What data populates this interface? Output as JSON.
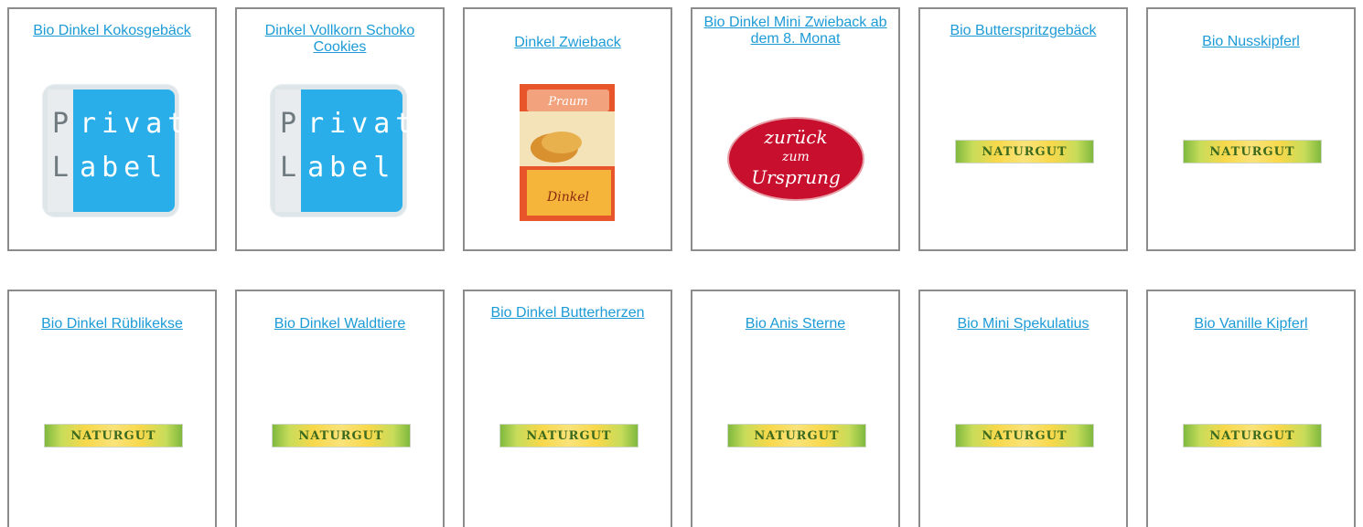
{
  "products": [
    {
      "title": "Bio Dinkel Kokosgebäck ",
      "logo": "private-label"
    },
    {
      "title": "Dinkel Vollkorn Schoko Cookies",
      "logo": "private-label"
    },
    {
      "title": "Dinkel Zwieback",
      "logo": "product-box"
    },
    {
      "title": "Bio Dinkel Mini Zwieback ab dem 8. Monat",
      "logo": "zurueck-zum-ursprung"
    },
    {
      "title": "Bio Butterspritzgebäck",
      "logo": "naturgut"
    },
    {
      "title": "Bio Nusskipferl",
      "logo": "naturgut"
    },
    {
      "title": "Bio Dinkel Rüblikekse",
      "logo": "naturgut"
    },
    {
      "title": "Bio Dinkel Waldtiere",
      "logo": "naturgut"
    },
    {
      "title": "Bio Dinkel Butterherzen",
      "logo": "naturgut"
    },
    {
      "title": "Bio Anis Sterne",
      "logo": "naturgut"
    },
    {
      "title": "Bio Mini Spekulatius",
      "logo": "naturgut"
    },
    {
      "title": "Bio Vanille Kipferl",
      "logo": "naturgut"
    }
  ],
  "logos": {
    "private_label": {
      "line1": [
        "P",
        "rivate"
      ],
      "line2": [
        "L",
        "abel"
      ]
    },
    "zwieback_box": {
      "brand": "Praum",
      "name": "Dinkel"
    },
    "zurueck": {
      "line1": "zurück",
      "line2": "zum",
      "line3": "Ursprung"
    },
    "naturgut": "NATURGUT"
  },
  "colors": {
    "link": "#1d9bd6",
    "border": "#8c8c8c",
    "private_blue": "#29aeea",
    "zurueck_red": "#c8102e"
  }
}
